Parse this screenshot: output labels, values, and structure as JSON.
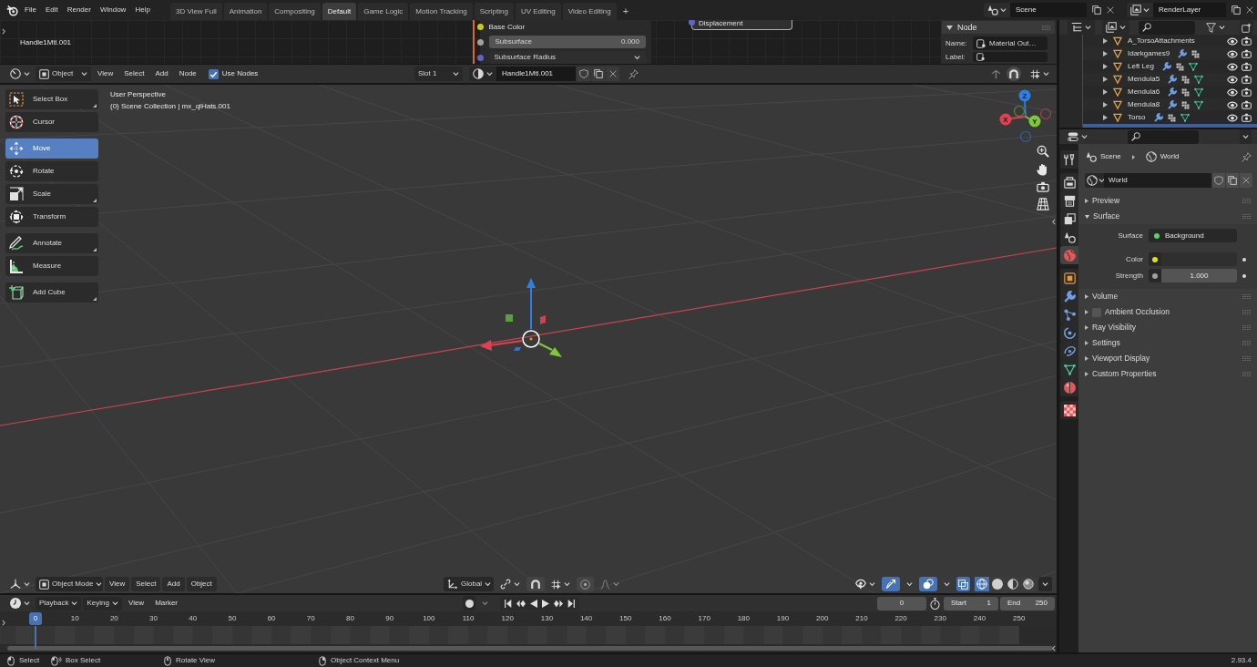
{
  "top_bar": {
    "menus": [
      "File",
      "Edit",
      "Render",
      "Window",
      "Help"
    ],
    "workspaces": [
      {
        "label": "3D View Full",
        "selected": false
      },
      {
        "label": "Animation",
        "selected": false
      },
      {
        "label": "Compositing",
        "selected": false
      },
      {
        "label": "Default",
        "selected": true
      },
      {
        "label": "Game Logic",
        "selected": false
      },
      {
        "label": "Motion Tracking",
        "selected": false
      },
      {
        "label": "Scripting",
        "selected": false
      },
      {
        "label": "UV Editing",
        "selected": false
      },
      {
        "label": "Video Editing",
        "selected": false
      }
    ],
    "add_workspace": "+",
    "scene": "Scene",
    "view_layer": "RenderLayer"
  },
  "shader_editor": {
    "tree_name": "Handle1Mtl.001",
    "node_inputs": [
      {
        "kind": "socket",
        "label": "Base Color",
        "color": "#c7c729"
      },
      {
        "kind": "number",
        "label": "Subsurface",
        "value": "0.000",
        "color": "#a1a1a1"
      },
      {
        "kind": "menu",
        "label": "Subsurface Radius",
        "color": "#6363c7"
      }
    ],
    "output_node": {
      "label": "Displacement"
    },
    "sidebar": {
      "panel": "Node",
      "name_label": "Name:",
      "name": "Material Out…",
      "label_label": "Label:"
    },
    "header": {
      "object_type": "Object",
      "menus": [
        "View",
        "Select",
        "Add",
        "Node"
      ],
      "use_nodes": {
        "label": "Use Nodes",
        "checked": true
      },
      "slot": "Slot 1",
      "material": "Handle1Mtl.001"
    }
  },
  "outliner": {
    "rows": [
      {
        "name": "A_TorsoAttachments",
        "modifiers": false,
        "mesh_data": false,
        "selected": false
      },
      {
        "name": "Idarkgames9",
        "modifiers": true,
        "mesh_data": false,
        "selected": false
      },
      {
        "name": "Left Leg",
        "modifiers": true,
        "mesh_data": true,
        "selected": false
      },
      {
        "name": "Mendula5",
        "modifiers": true,
        "mesh_data": true,
        "selected": false
      },
      {
        "name": "Mendula6",
        "modifiers": true,
        "mesh_data": true,
        "selected": false
      },
      {
        "name": "Mendula8",
        "modifiers": true,
        "mesh_data": true,
        "selected": false
      },
      {
        "name": "Torso",
        "modifiers": true,
        "mesh_data": true,
        "selected": false
      },
      {
        "selected": true
      }
    ]
  },
  "viewport": {
    "tool_groups": [
      {
        "tools": [
          {
            "kind": "select_box",
            "label": "Select Box",
            "selected": false,
            "variants": true
          },
          {
            "kind": "cursor",
            "label": "Cursor",
            "selected": false,
            "variants": false
          }
        ]
      },
      {
        "tools": [
          {
            "kind": "move",
            "label": "Move",
            "selected": true,
            "variants": false
          },
          {
            "kind": "rotate",
            "label": "Rotate",
            "selected": false,
            "variants": false
          },
          {
            "kind": "scale",
            "label": "Scale",
            "selected": false,
            "variants": true
          },
          {
            "kind": "transform",
            "label": "Transform",
            "selected": false,
            "variants": false
          }
        ]
      },
      {
        "tools": [
          {
            "kind": "annotate",
            "label": "Annotate",
            "selected": false,
            "variants": true
          },
          {
            "kind": "measure",
            "label": "Measure",
            "selected": false,
            "variants": false
          }
        ]
      },
      {
        "tools": [
          {
            "kind": "add_cube",
            "label": "Add Cube",
            "selected": false,
            "variants": true
          }
        ]
      }
    ],
    "info": [
      "User Perspective",
      "(0) Scene Collection | mx_qlHats.001"
    ],
    "gizmo_axes": [
      "X",
      "Y",
      "Z"
    ],
    "header": {
      "mode": "Object Mode",
      "menus": [
        "View",
        "Select",
        "Add",
        "Object"
      ],
      "orientation": "Global",
      "snap": false,
      "proportional_editing": false,
      "gizmos": true,
      "overlays": true,
      "xray": true,
      "shading": [
        {
          "kind": "wireframe",
          "selected": true
        },
        {
          "kind": "solid",
          "selected": false
        },
        {
          "kind": "material",
          "selected": false
        },
        {
          "kind": "rendered",
          "selected": false
        }
      ]
    }
  },
  "properties": {
    "tab_groups": [
      {
        "tabs": [
          {
            "kind": "tool",
            "selected": false
          }
        ]
      },
      {
        "tabs": [
          {
            "kind": "render",
            "selected": false
          },
          {
            "kind": "output",
            "selected": false
          },
          {
            "kind": "view_layer",
            "selected": false
          },
          {
            "kind": "scene",
            "selected": false
          },
          {
            "kind": "world",
            "selected": true
          }
        ]
      },
      {
        "tabs": [
          {
            "kind": "object",
            "selected": false
          },
          {
            "kind": "modifiers",
            "selected": false
          },
          {
            "kind": "particles",
            "selected": false
          },
          {
            "kind": "physics",
            "selected": false
          },
          {
            "kind": "constraints",
            "selected": false
          },
          {
            "kind": "data",
            "selected": false
          },
          {
            "kind": "material",
            "selected": false
          }
        ]
      },
      {
        "tabs": [
          {
            "kind": "texture",
            "selected": false
          }
        ]
      }
    ],
    "breadcrumb": [
      {
        "kind": "scene",
        "label": "Scene"
      },
      {
        "kind": "world",
        "label": "World"
      }
    ],
    "world": "World",
    "panels": [
      {
        "title": "Preview",
        "expanded": false
      },
      {
        "title": "Surface",
        "expanded": true,
        "fields": [
          {
            "kind": "node",
            "label": "Surface",
            "value": "Background",
            "color": "#5fd15f"
          },
          {
            "kind": "color",
            "label": "Color",
            "color": "#e0e020"
          },
          {
            "kind": "number",
            "label": "Strength",
            "value": "1.000",
            "color": "#a1a1a1"
          }
        ]
      },
      {
        "title": "Volume",
        "expanded": false
      },
      {
        "title": "Ambient Occlusion",
        "expanded": false,
        "checked": false
      },
      {
        "title": "Ray Visibility",
        "expanded": false
      },
      {
        "title": "Settings",
        "expanded": false
      },
      {
        "title": "Viewport Display",
        "expanded": false
      },
      {
        "title": "Custom Properties",
        "expanded": false
      }
    ]
  },
  "timeline": {
    "menus": [
      {
        "label": "Playback",
        "kind": "dropdown"
      },
      {
        "label": "Keying",
        "kind": "dropdown"
      },
      {
        "label": "View",
        "kind": "plain"
      },
      {
        "label": "Marker",
        "kind": "plain"
      }
    ],
    "auto_keying": false,
    "current_frame": "0",
    "start_label": "Start",
    "start": "1",
    "end_label": "End",
    "end": "250",
    "ticks": [
      {
        "label": "0",
        "selected": true
      },
      {
        "label": "10",
        "selected": false
      },
      {
        "label": "20",
        "selected": false
      },
      {
        "label": "30",
        "selected": false
      },
      {
        "label": "40",
        "selected": false
      },
      {
        "label": "50",
        "selected": false
      },
      {
        "label": "60",
        "selected": false
      },
      {
        "label": "70",
        "selected": false
      },
      {
        "label": "80",
        "selected": false
      },
      {
        "label": "90",
        "selected": false
      },
      {
        "label": "100",
        "selected": false
      },
      {
        "label": "110",
        "selected": false
      },
      {
        "label": "120",
        "selected": false
      },
      {
        "label": "130",
        "selected": false
      },
      {
        "label": "140",
        "selected": false
      },
      {
        "label": "150",
        "selected": false
      },
      {
        "label": "160",
        "selected": false
      },
      {
        "label": "170",
        "selected": false
      },
      {
        "label": "180",
        "selected": false
      },
      {
        "label": "190",
        "selected": false
      },
      {
        "label": "200",
        "selected": false
      },
      {
        "label": "210",
        "selected": false
      },
      {
        "label": "220",
        "selected": false
      },
      {
        "label": "230",
        "selected": false
      },
      {
        "label": "240",
        "selected": false
      },
      {
        "label": "250",
        "selected": false
      }
    ]
  },
  "status_bar": {
    "hints": [
      {
        "kind": "left",
        "label": "Select"
      },
      {
        "kind": "left_drag",
        "label": "Box Select"
      },
      {
        "kind": "middle",
        "label": "Rotate View"
      },
      {
        "kind": "right",
        "label": "Object Context Menu"
      }
    ],
    "version": "2.93.4"
  }
}
